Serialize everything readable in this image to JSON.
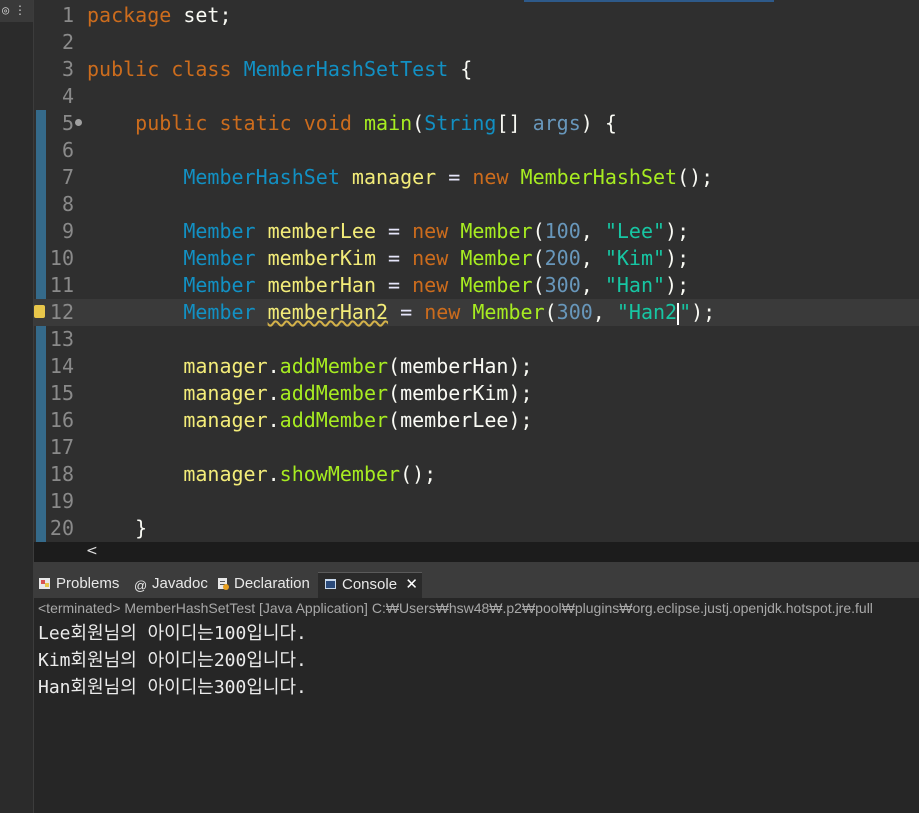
{
  "editor": {
    "lines": [
      {
        "n": "1",
        "tokens": [
          {
            "c": "k",
            "t": "package"
          },
          {
            "c": "p",
            "t": " set;"
          }
        ]
      },
      {
        "n": "2",
        "tokens": []
      },
      {
        "n": "3",
        "tokens": [
          {
            "c": "k",
            "t": "public"
          },
          {
            "c": "p",
            "t": " "
          },
          {
            "c": "k",
            "t": "class"
          },
          {
            "c": "p",
            "t": " "
          },
          {
            "c": "t",
            "t": "MemberHashSetTest"
          },
          {
            "c": "p",
            "t": " {"
          }
        ]
      },
      {
        "n": "4",
        "tokens": []
      },
      {
        "n": "5",
        "tokens": [
          {
            "c": "p",
            "t": "    "
          },
          {
            "c": "k",
            "t": "public"
          },
          {
            "c": "p",
            "t": " "
          },
          {
            "c": "k",
            "t": "static"
          },
          {
            "c": "p",
            "t": " "
          },
          {
            "c": "k",
            "t": "void"
          },
          {
            "c": "p",
            "t": " "
          },
          {
            "c": "f",
            "t": "main"
          },
          {
            "c": "p",
            "t": "("
          },
          {
            "c": "t",
            "t": "String"
          },
          {
            "c": "p",
            "t": "[] "
          },
          {
            "c": "n",
            "t": "args"
          },
          {
            "c": "p",
            "t": ") {"
          }
        ]
      },
      {
        "n": "6",
        "tokens": []
      },
      {
        "n": "7",
        "tokens": [
          {
            "c": "p",
            "t": "        "
          },
          {
            "c": "t",
            "t": "MemberHashSet"
          },
          {
            "c": "p",
            "t": " "
          },
          {
            "c": "v",
            "t": "manager"
          },
          {
            "c": "p",
            "t": " "
          },
          {
            "c": "op",
            "t": "="
          },
          {
            "c": "p",
            "t": " "
          },
          {
            "c": "k",
            "t": "new"
          },
          {
            "c": "p",
            "t": " "
          },
          {
            "c": "f",
            "t": "MemberHashSet"
          },
          {
            "c": "p",
            "t": "();"
          }
        ]
      },
      {
        "n": "8",
        "tokens": []
      },
      {
        "n": "9",
        "tokens": [
          {
            "c": "p",
            "t": "        "
          },
          {
            "c": "t",
            "t": "Member"
          },
          {
            "c": "p",
            "t": " "
          },
          {
            "c": "v",
            "t": "memberLee"
          },
          {
            "c": "p",
            "t": " "
          },
          {
            "c": "op",
            "t": "="
          },
          {
            "c": "p",
            "t": " "
          },
          {
            "c": "k",
            "t": "new"
          },
          {
            "c": "p",
            "t": " "
          },
          {
            "c": "f",
            "t": "Member"
          },
          {
            "c": "p",
            "t": "("
          },
          {
            "c": "n",
            "t": "100"
          },
          {
            "c": "p",
            "t": ", "
          },
          {
            "c": "s",
            "t": "\"Lee\""
          },
          {
            "c": "p",
            "t": ");"
          }
        ]
      },
      {
        "n": "10",
        "tokens": [
          {
            "c": "p",
            "t": "        "
          },
          {
            "c": "t",
            "t": "Member"
          },
          {
            "c": "p",
            "t": " "
          },
          {
            "c": "v",
            "t": "memberKim"
          },
          {
            "c": "p",
            "t": " "
          },
          {
            "c": "op",
            "t": "="
          },
          {
            "c": "p",
            "t": " "
          },
          {
            "c": "k",
            "t": "new"
          },
          {
            "c": "p",
            "t": " "
          },
          {
            "c": "f",
            "t": "Member"
          },
          {
            "c": "p",
            "t": "("
          },
          {
            "c": "n",
            "t": "200"
          },
          {
            "c": "p",
            "t": ", "
          },
          {
            "c": "s",
            "t": "\"Kim\""
          },
          {
            "c": "p",
            "t": ");"
          }
        ]
      },
      {
        "n": "11",
        "tokens": [
          {
            "c": "p",
            "t": "        "
          },
          {
            "c": "t",
            "t": "Member"
          },
          {
            "c": "p",
            "t": " "
          },
          {
            "c": "v",
            "t": "memberHan"
          },
          {
            "c": "p",
            "t": " "
          },
          {
            "c": "op",
            "t": "="
          },
          {
            "c": "p",
            "t": " "
          },
          {
            "c": "k",
            "t": "new"
          },
          {
            "c": "p",
            "t": " "
          },
          {
            "c": "f",
            "t": "Member"
          },
          {
            "c": "p",
            "t": "("
          },
          {
            "c": "n",
            "t": "300"
          },
          {
            "c": "p",
            "t": ", "
          },
          {
            "c": "s",
            "t": "\"Han\""
          },
          {
            "c": "p",
            "t": ");"
          }
        ]
      },
      {
        "n": "12",
        "current": true,
        "warning": true,
        "tokens": [
          {
            "c": "p",
            "t": "        "
          },
          {
            "c": "t",
            "t": "Member"
          },
          {
            "c": "p",
            "t": " "
          },
          {
            "c": "v uw",
            "t": "memberHan2"
          },
          {
            "c": "p",
            "t": " "
          },
          {
            "c": "op",
            "t": "="
          },
          {
            "c": "p",
            "t": " "
          },
          {
            "c": "k",
            "t": "new"
          },
          {
            "c": "p",
            "t": " "
          },
          {
            "c": "f",
            "t": "Member"
          },
          {
            "c": "p",
            "t": "("
          },
          {
            "c": "n",
            "t": "300"
          },
          {
            "c": "p",
            "t": ", "
          },
          {
            "c": "s",
            "t": "\"Han2"
          },
          {
            "c": "caret",
            "t": ""
          },
          {
            "c": "s",
            "t": "\""
          },
          {
            "c": "p",
            "t": ");"
          }
        ]
      },
      {
        "n": "13",
        "tokens": []
      },
      {
        "n": "14",
        "tokens": [
          {
            "c": "p",
            "t": "        "
          },
          {
            "c": "v",
            "t": "manager"
          },
          {
            "c": "p",
            "t": "."
          },
          {
            "c": "f",
            "t": "addMember"
          },
          {
            "c": "p",
            "t": "(memberHan);"
          }
        ]
      },
      {
        "n": "15",
        "tokens": [
          {
            "c": "p",
            "t": "        "
          },
          {
            "c": "v",
            "t": "manager"
          },
          {
            "c": "p",
            "t": "."
          },
          {
            "c": "f",
            "t": "addMember"
          },
          {
            "c": "p",
            "t": "(memberKim);"
          }
        ]
      },
      {
        "n": "16",
        "tokens": [
          {
            "c": "p",
            "t": "        "
          },
          {
            "c": "v",
            "t": "manager"
          },
          {
            "c": "p",
            "t": "."
          },
          {
            "c": "f",
            "t": "addMember"
          },
          {
            "c": "p",
            "t": "(memberLee);"
          }
        ]
      },
      {
        "n": "17",
        "tokens": []
      },
      {
        "n": "18",
        "tokens": [
          {
            "c": "p",
            "t": "        "
          },
          {
            "c": "v",
            "t": "manager"
          },
          {
            "c": "p",
            "t": "."
          },
          {
            "c": "f",
            "t": "showMember"
          },
          {
            "c": "p",
            "t": "();"
          }
        ]
      },
      {
        "n": "19",
        "tokens": []
      },
      {
        "n": "20",
        "tokens": [
          {
            "c": "p",
            "t": "    }"
          }
        ]
      }
    ]
  },
  "scroll": {
    "left_arrow": "<"
  },
  "tabs": [
    {
      "label": "Problems",
      "icon": "problems-icon",
      "active": false
    },
    {
      "label": "Javadoc",
      "icon": "javadoc-icon",
      "active": false
    },
    {
      "label": "Declaration",
      "icon": "declaration-icon",
      "active": false
    },
    {
      "label": "Console",
      "icon": "console-icon",
      "active": true
    }
  ],
  "console": {
    "status": "<terminated> MemberHashSetTest [Java Application] C:₩Users₩hsw48₩.p2₩pool₩plugins₩org.eclipse.justj.openjdk.hotspot.jre.full",
    "output": [
      "Lee회원님의 아이디는100입니다.",
      "Kim회원님의 아이디는200입니다.",
      "Han회원님의 아이디는300입니다."
    ]
  },
  "colors": {
    "keyword": "#cc6c1d",
    "type": "#1290c3",
    "method": "#a7ec21",
    "variable": "#f3ec79",
    "string": "#17c6a3",
    "number": "#6897bb"
  }
}
